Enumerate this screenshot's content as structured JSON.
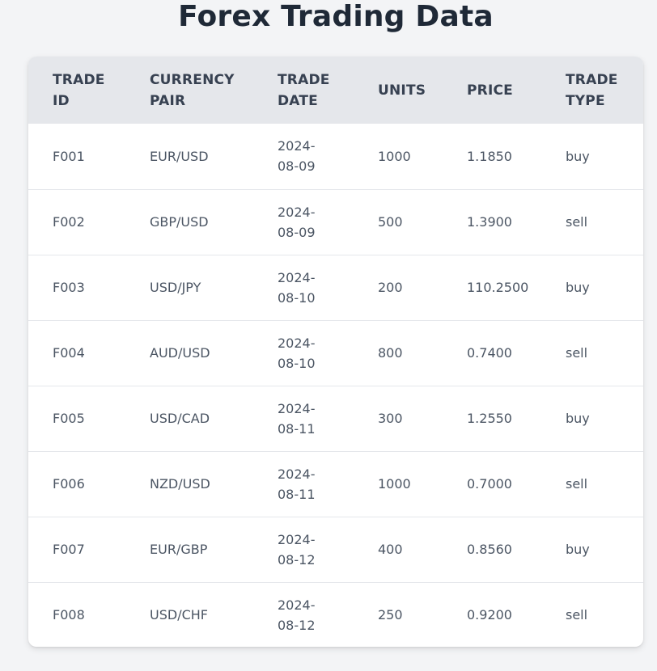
{
  "page": {
    "title": "Forex Trading Data"
  },
  "table": {
    "headers": [
      "Trade ID",
      "Currency Pair",
      "Trade Date",
      "Units",
      "Price",
      "Trade Type"
    ],
    "rows": [
      {
        "trade_id": "F001",
        "currency_pair": "EUR/USD",
        "trade_date": [
          "2024-",
          "08-09"
        ],
        "units": "1000",
        "price": "1.1850",
        "trade_type": "buy"
      },
      {
        "trade_id": "F002",
        "currency_pair": "GBP/USD",
        "trade_date": [
          "2024-",
          "08-09"
        ],
        "units": "500",
        "price": "1.3900",
        "trade_type": "sell"
      },
      {
        "trade_id": "F003",
        "currency_pair": "USD/JPY",
        "trade_date": [
          "2024-",
          "08-10"
        ],
        "units": "200",
        "price": "110.2500",
        "trade_type": "buy"
      },
      {
        "trade_id": "F004",
        "currency_pair": "AUD/USD",
        "trade_date": [
          "2024-",
          "08-10"
        ],
        "units": "800",
        "price": "0.7400",
        "trade_type": "sell"
      },
      {
        "trade_id": "F005",
        "currency_pair": "USD/CAD",
        "trade_date": [
          "2024-",
          "08-11"
        ],
        "units": "300",
        "price": "1.2550",
        "trade_type": "buy"
      },
      {
        "trade_id": "F006",
        "currency_pair": "NZD/USD",
        "trade_date": [
          "2024-",
          "08-11"
        ],
        "units": "1000",
        "price": "0.7000",
        "trade_type": "sell"
      },
      {
        "trade_id": "F007",
        "currency_pair": "EUR/GBP",
        "trade_date": [
          "2024-",
          "08-12"
        ],
        "units": "400",
        "price": "0.8560",
        "trade_type": "buy"
      },
      {
        "trade_id": "F008",
        "currency_pair": "USD/CHF",
        "trade_date": [
          "2024-",
          "08-12"
        ],
        "units": "250",
        "price": "0.9200",
        "trade_type": "sell"
      }
    ]
  }
}
